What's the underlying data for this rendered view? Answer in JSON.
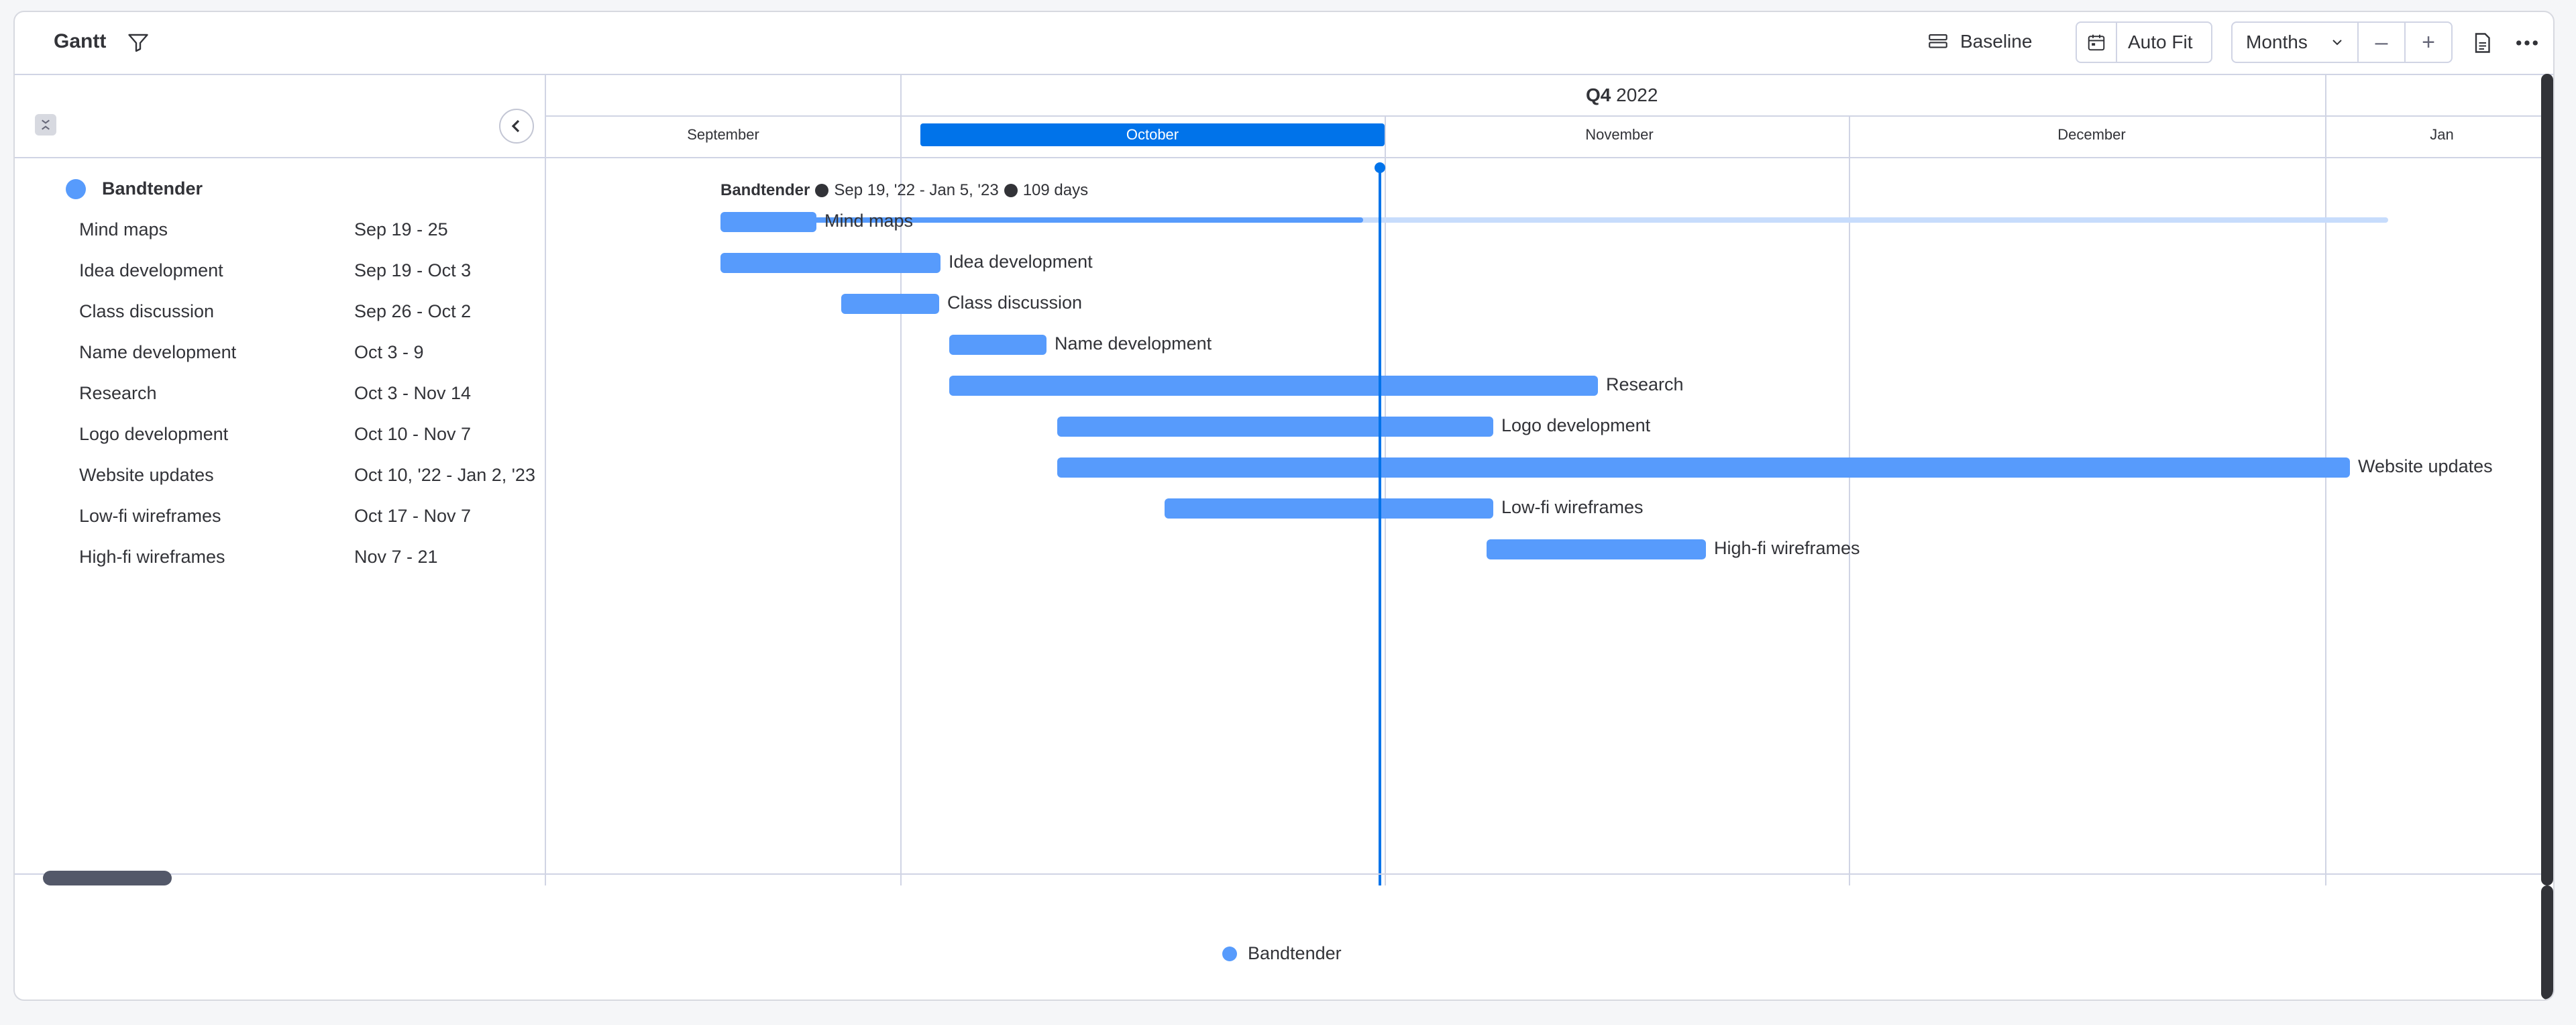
{
  "toolbar": {
    "title": "Gantt",
    "baseline_label": "Baseline",
    "autofit_label": "Auto Fit",
    "zoom_select": "Months",
    "zoom_out": "–",
    "zoom_in": "+"
  },
  "timeline": {
    "quarter_prefix": "Q4",
    "quarter_year": "2022",
    "months": [
      "September",
      "October",
      "November",
      "December",
      "Jan"
    ],
    "current_month": "October"
  },
  "group": {
    "name": "Bandtender",
    "color": "#579bfc",
    "summary_range": "Sep 19, '22 - Jan 5, '23",
    "summary_days": "109 days"
  },
  "tasks": [
    {
      "name": "Mind maps",
      "dates": "Sep 19 - 25"
    },
    {
      "name": "Idea development",
      "dates": "Sep 19 - Oct 3"
    },
    {
      "name": "Class discussion",
      "dates": "Sep 26 - Oct 2"
    },
    {
      "name": "Name development",
      "dates": "Oct 3 - 9"
    },
    {
      "name": "Research",
      "dates": "Oct 3 - Nov 14"
    },
    {
      "name": "Logo development",
      "dates": "Oct 10 - Nov 7"
    },
    {
      "name": "Website updates",
      "dates": "Oct 10, '22 - Jan 2, '23"
    },
    {
      "name": "Low-fi wireframes",
      "dates": "Oct 17 - Nov 7"
    },
    {
      "name": "High-fi wireframes",
      "dates": "Nov 7 - 21"
    }
  ],
  "legend": {
    "label": "Bandtender"
  },
  "colors": {
    "accent": "#0073ea",
    "bar": "#579bfc",
    "summary_light": "#c7dcfc"
  }
}
